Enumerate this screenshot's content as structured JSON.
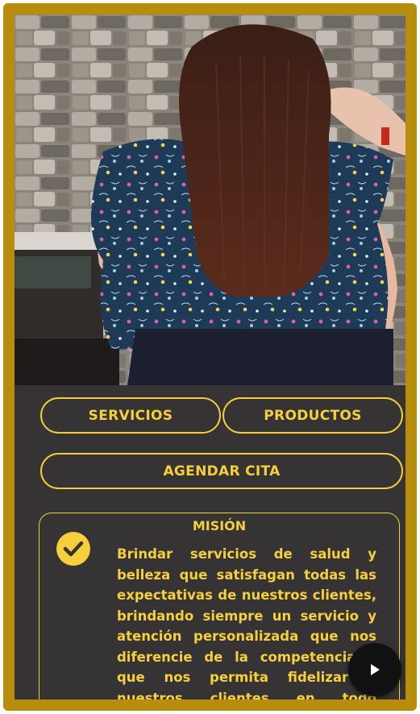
{
  "buttons": {
    "servicios": "SERVICIOS",
    "productos": "PRODUCTOS",
    "agendar": "AGENDAR CITA"
  },
  "mision": {
    "title": "MISIÓN",
    "text": "Brindar servicios de salud y belleza que satisfagan todas las expectativas de nuestros clientes, brindando siempre un servicio y atención personalizada que nos diferencie de la competencia y que nos permita fidelizar a nuestros clientes en todo momento."
  },
  "icons": {
    "check": "check-circle-icon",
    "play": "play-icon"
  },
  "colors": {
    "accent": "#f6cf3c",
    "frame": "#b88c0c",
    "background": "#353333"
  }
}
